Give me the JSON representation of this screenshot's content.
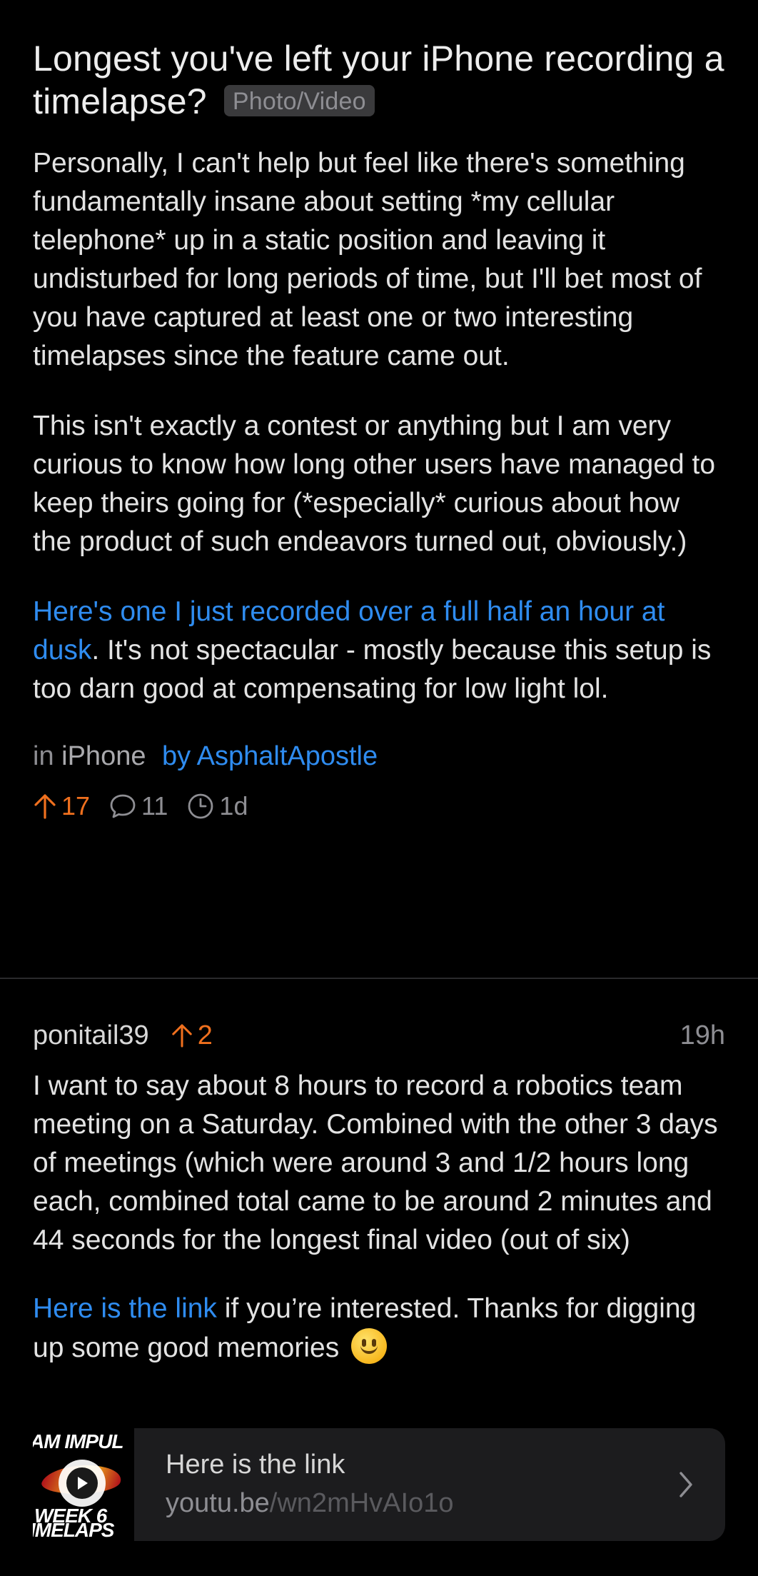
{
  "post": {
    "title": "Longest you've left your iPhone recording a timelapse?",
    "flair": "Photo/Video",
    "paragraphs": [
      "Personally, I can't help but feel like there's something fundamentally insane about setting *my cellular telephone* up in a static position and leaving it undisturbed for long periods of time, but I'll bet most of you have captured at least one or two interesting timelapses since the feature came out.",
      "This isn't exactly a contest or anything but I am very curious to know how long other users have managed to keep theirs going for (*especially* curious about how the product of such endeavors turned out, obviously.)"
    ],
    "link_text": "Here's one I just recorded over a full half an hour at dusk",
    "after_link_text": ". It's not spectacular - mostly because this setup is too darn good at compensating for low light lol.",
    "meta": {
      "in_label": "in",
      "subreddit": "iPhone",
      "by_label": "by",
      "author": "AsphaltApostle"
    },
    "stats": {
      "upvotes": "17",
      "comments": "11",
      "age": "1d"
    }
  },
  "comment": {
    "author": "ponitail39",
    "score": "2",
    "time": "19h",
    "paragraph": "I want to say about 8 hours to record a robotics team meeting on a Saturday. Combined with the other 3 days of meetings (which were around 3 and 1/2 hours long each, combined total came to be around 2 minutes and 44 seconds for the longest final video (out of six)",
    "link_text": "Here is the link",
    "after_link_text": " if you’re interested. Thanks for digging up some good memories",
    "emoji": "slightly-smiling-face",
    "link_card": {
      "title": "Here is the link",
      "domain": "youtu.be",
      "path": "/wn2mHvAIo1o",
      "thumbnail_lines": [
        "AM IMPUL",
        "WEEK 6",
        "IMELAPS"
      ]
    }
  },
  "colors": {
    "background": "#000000",
    "link": "#2f8cf0",
    "upvote": "#f0701e",
    "muted": "#8e8e93",
    "card": "#1c1c1e"
  }
}
